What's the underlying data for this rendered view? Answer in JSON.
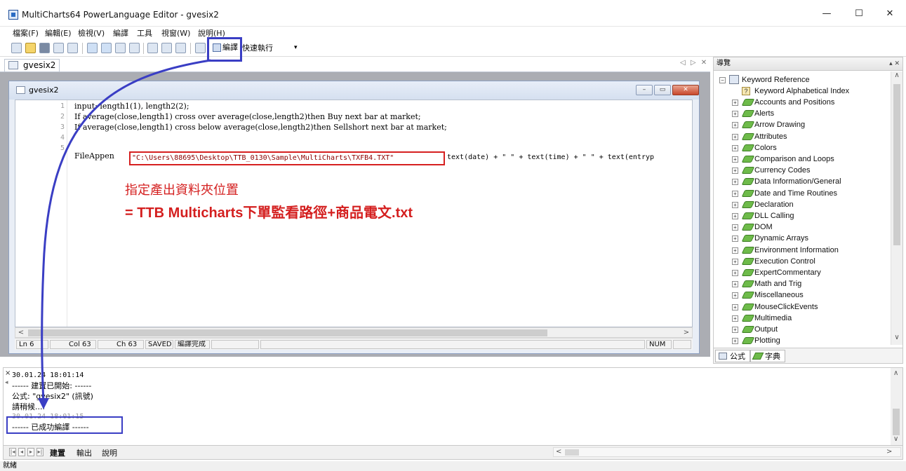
{
  "window": {
    "title": "MultiCharts64 PowerLanguage Editor - gvesix2",
    "minimize": "—",
    "maximize": "☐",
    "close": "✕"
  },
  "menu": [
    "檔案(F)",
    "編輯(E)",
    "檢視(V)",
    "編譯",
    "工具",
    "視窗(W)",
    "說明(H)"
  ],
  "toolbar": {
    "compile_label": "編譯",
    "quickrun_label": "快速執行",
    "quickrun_arrow": "▾"
  },
  "doc_tab": {
    "label": "gvesix2",
    "nav": "◁ ▷ ✕"
  },
  "child_window": {
    "title": "gvesix2",
    "buttons": [
      "–",
      "▭",
      "✕"
    ]
  },
  "editor": {
    "line_numbers": [
      "1",
      "2",
      "3",
      "4",
      "5"
    ],
    "line1": "input: length1(1), length2(2);",
    "line2": "If average(close,length1) cross over average(close,length2)then Buy next bar at market;",
    "line3": "If average(close,length1) cross below average(close,length2)then Sellshort next bar at market;",
    "line5_prefix": "FileAppen",
    "path_string": "\"C:\\Users\\88695\\Desktop\\TTB_0130\\Sample\\MultiCharts\\TXFB4.TXT\"",
    "line5_rest": "text(date) + \" \" + text(time) + \" \" + text(entryp",
    "annotation_line1": "指定產出資料夾位置",
    "annotation_line2": "= TTB Multicharts下單監看路徑+商品電文.txt"
  },
  "scroll_glyphs": {
    "left": "<",
    "right": ">",
    "up": "∧",
    "down": "∨"
  },
  "status": {
    "ln": "Ln 6",
    "col": "Col 63",
    "ch": "Ch 63",
    "saved": "SAVED",
    "compiled": "編譯完成",
    "num": "NUM"
  },
  "right_panel": {
    "title": "導覽",
    "pin": "▴ ✕",
    "root": "Keyword Reference",
    "index": "Keyword Alphabetical Index",
    "categories": [
      "Accounts and Positions",
      "Alerts",
      "Arrow Drawing",
      "Attributes",
      "Colors",
      "Comparison and Loops",
      "Currency Codes",
      "Data Information/General",
      "Date and Time Routines",
      "Declaration",
      "DLL Calling",
      "DOM",
      "Dynamic Arrays",
      "Environment Information",
      "Execution Control",
      "ExpertCommentary",
      "Math and Trig",
      "Miscellaneous",
      "MouseClickEvents",
      "Multimedia",
      "Output",
      "Plotting"
    ],
    "tabs": [
      "公式",
      "字典"
    ]
  },
  "output": {
    "lines": [
      "30.01.24 18:01:14",
      "------ 建置已開始: ------",
      "公式: \"gvesix2\" (訊號)",
      "請稍候....",
      "30.01.24 18:01:15",
      "------ 已成功編譯 ------"
    ],
    "close_glyph": "×",
    "tabs": [
      "建置",
      "輸出",
      "說明"
    ]
  },
  "app_status": "就緒",
  "colors": {
    "annotation_red": "#d41f1f",
    "highlight_blue": "#3a3ec4"
  }
}
